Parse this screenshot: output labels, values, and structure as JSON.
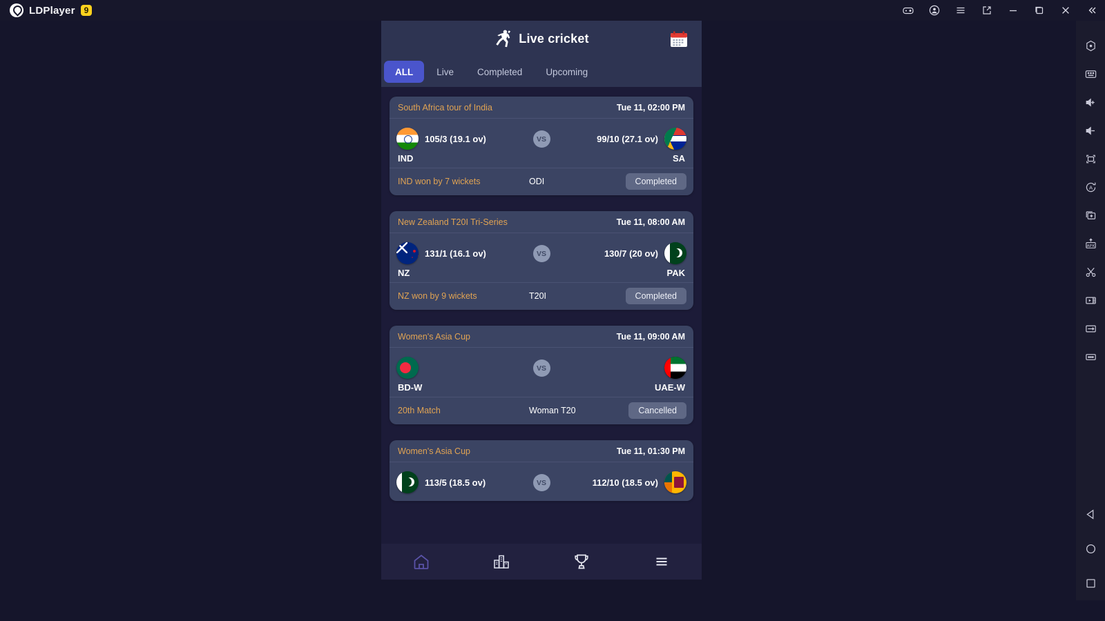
{
  "window": {
    "brand_name": "LDPlayer",
    "brand_version": "9",
    "titlebar_buttons": [
      {
        "name": "gamepad-icon",
        "label": "Gamepad"
      },
      {
        "name": "account-icon",
        "label": "Account"
      },
      {
        "name": "menu-icon",
        "label": "Menu"
      },
      {
        "name": "share-icon",
        "label": "Share"
      },
      {
        "name": "minimize-icon",
        "label": "Minimize"
      },
      {
        "name": "maximize-icon",
        "label": "Maximize"
      },
      {
        "name": "close-icon",
        "label": "Close"
      },
      {
        "name": "collapse-icon",
        "label": "Collapse"
      }
    ],
    "toolbar_buttons": [
      {
        "name": "location-icon",
        "label": "Location"
      },
      {
        "name": "keyboard-icon",
        "label": "Keyboard mapping"
      },
      {
        "name": "volume-up-icon",
        "label": "Volume up"
      },
      {
        "name": "volume-down-icon",
        "label": "Volume down"
      },
      {
        "name": "fullscreen-icon",
        "label": "Fullscreen"
      },
      {
        "name": "rotate-auto-icon",
        "label": "Auto rotate"
      },
      {
        "name": "multi-instance-icon",
        "label": "Multi instance"
      },
      {
        "name": "apk-install-icon",
        "label": "Install APK"
      },
      {
        "name": "scissors-icon",
        "label": "Screenshot cut"
      },
      {
        "name": "video-record-icon",
        "label": "Record"
      },
      {
        "name": "sync-icon",
        "label": "Synchronizer"
      },
      {
        "name": "more-icon",
        "label": "More"
      }
    ],
    "android_nav": [
      {
        "name": "back-button",
        "label": "Back"
      },
      {
        "name": "home-button",
        "label": "Home"
      },
      {
        "name": "recents-button",
        "label": "Recents"
      }
    ]
  },
  "app": {
    "title": "Live cricket",
    "title_icon": "cricket-batsman-icon",
    "calendar_icon": "calendar-icon",
    "tabs": [
      {
        "label": "ALL",
        "active": true
      },
      {
        "label": "Live",
        "active": false
      },
      {
        "label": "Completed",
        "active": false
      },
      {
        "label": "Upcoming",
        "active": false
      }
    ],
    "matches": [
      {
        "series": "South Africa tour of India",
        "time": "Tue 11, 02:00 PM",
        "team1": {
          "code": "IND",
          "score": "105/3 (19.1 ov)",
          "flag": "f-ind"
        },
        "team2": {
          "code": "SA",
          "score": "99/10 (27.1 ov)",
          "flag": "f-sa"
        },
        "vs": "VS",
        "result": "IND won by 7 wickets",
        "format": "ODI",
        "status": "Completed"
      },
      {
        "series": "New Zealand T20I Tri-Series",
        "time": "Tue 11, 08:00 AM",
        "team1": {
          "code": "NZ",
          "score": "131/1 (16.1 ov)",
          "flag": "f-nz"
        },
        "team2": {
          "code": "PAK",
          "score": "130/7 (20 ov)",
          "flag": "f-pak"
        },
        "vs": "VS",
        "result": "NZ won by 9 wickets",
        "format": "T20I",
        "status": "Completed"
      },
      {
        "series": "Women's Asia Cup",
        "time": "Tue 11, 09:00 AM",
        "team1": {
          "code": "BD-W",
          "score": "",
          "flag": "f-bd"
        },
        "team2": {
          "code": "UAE-W",
          "score": "",
          "flag": "f-uae"
        },
        "vs": "VS",
        "result": "20th Match",
        "format": "Woman T20",
        "status": "Cancelled"
      },
      {
        "series": "Women's Asia Cup",
        "time": "Tue 11, 01:30 PM",
        "team1": {
          "code": "",
          "score": "113/5 (18.5 ov)",
          "flag": "f-pak"
        },
        "team2": {
          "code": "",
          "score": "112/10 (18.5 ov)",
          "flag": "f-sl"
        },
        "vs": "VS",
        "result": "",
        "format": "",
        "status": ""
      }
    ],
    "bottom_nav": [
      {
        "name": "nav-home-icon",
        "label": "Home",
        "active": true
      },
      {
        "name": "nav-series-icon",
        "label": "Series",
        "active": false
      },
      {
        "name": "nav-ranking-icon",
        "label": "Ranking",
        "active": false
      },
      {
        "name": "nav-more-icon",
        "label": "More",
        "active": false
      }
    ]
  },
  "colors": {
    "desktop_bg": "#1c1b38",
    "card_bg": "#3b4463",
    "header_bg": "#2e3452",
    "accent_tab": "#4a55cc",
    "series_text": "#e0a353",
    "badge_bg": "#5f6885",
    "brand_badge": "#ffd21e"
  }
}
